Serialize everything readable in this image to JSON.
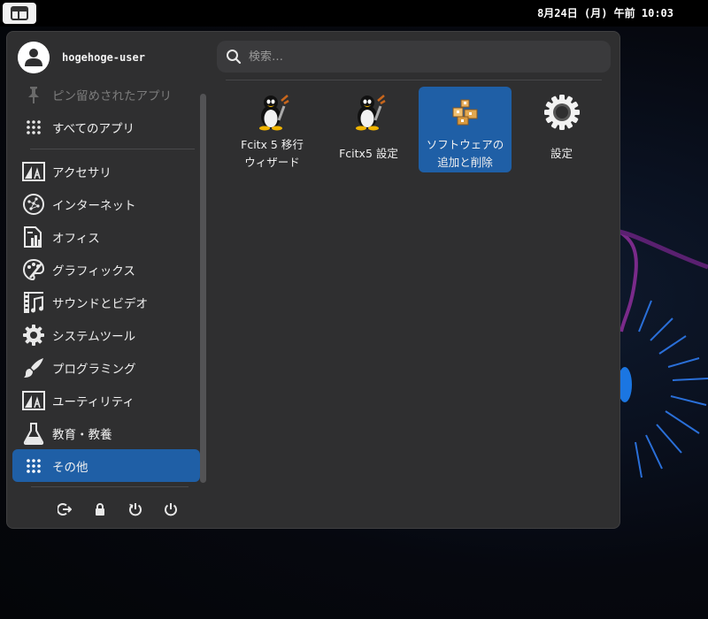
{
  "top_panel": {
    "clock": "8月24日 (月) 午前 10:03",
    "launcher_icon": "menu-layout-icon"
  },
  "user": {
    "name": "hogehoge-user",
    "avatar_icon": "user-icon"
  },
  "search": {
    "placeholder": "検索…",
    "value": ""
  },
  "sidebar": {
    "pinned": {
      "label": "ピン留めされたアプリ",
      "icon": "pin-icon"
    },
    "all_apps": {
      "label": "すべてのアプリ",
      "icon": "grid-icon"
    },
    "categories": [
      {
        "label": "アクセサリ",
        "icon": "accessories-icon"
      },
      {
        "label": "インターネット",
        "icon": "internet-icon"
      },
      {
        "label": "オフィス",
        "icon": "office-icon"
      },
      {
        "label": "グラフィックス",
        "icon": "graphics-icon"
      },
      {
        "label": "サウンドとビデオ",
        "icon": "multimedia-icon"
      },
      {
        "label": "システムツール",
        "icon": "system-tools-icon"
      },
      {
        "label": "プログラミング",
        "icon": "programming-icon"
      },
      {
        "label": "ユーティリティ",
        "icon": "utilities-icon"
      },
      {
        "label": "教育・教養",
        "icon": "education-icon"
      },
      {
        "label": "その他",
        "icon": "grid-icon",
        "selected": true
      }
    ]
  },
  "actions": [
    "logout-icon",
    "lock-icon",
    "restart-icon",
    "power-icon"
  ],
  "apps": [
    {
      "name_line1": "Fcitx 5 移行",
      "name_line2": "ウィザード",
      "icon": "tux-icon"
    },
    {
      "name_line1": "Fcitx5 設定",
      "name_line2": "",
      "icon": "tux-icon"
    },
    {
      "name_line1": "ソフトウェアの",
      "name_line2": "追加と削除",
      "icon": "package-icon",
      "selected": true
    },
    {
      "name_line1": "設定",
      "name_line2": "",
      "icon": "gear-icon"
    }
  ],
  "colors": {
    "selection": "#1f5fa6",
    "panel": "#2f2f30",
    "topbar": "#000000"
  }
}
